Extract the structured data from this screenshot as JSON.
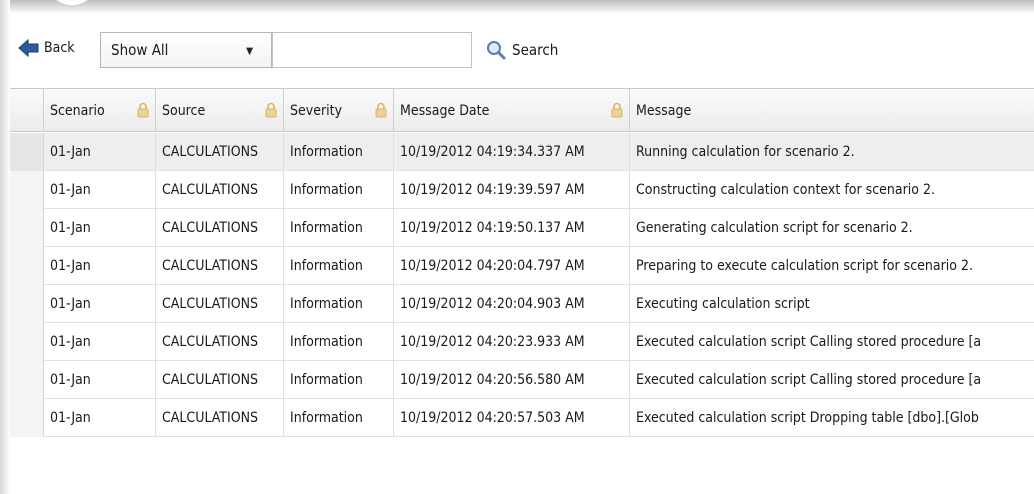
{
  "toolbar": {
    "back_label": "Back",
    "filter_selected": "Show All",
    "search_value": "",
    "search_label": "Search"
  },
  "grid": {
    "columns": [
      "Scenario",
      "Source",
      "Severity",
      "Message Date",
      "Message"
    ],
    "rows": [
      {
        "scenario": "01-Jan",
        "source": "CALCULATIONS",
        "severity": "Information",
        "date": "10/19/2012 04:19:34.337 AM",
        "message": "Running calculation for scenario 2."
      },
      {
        "scenario": "01-Jan",
        "source": "CALCULATIONS",
        "severity": "Information",
        "date": "10/19/2012 04:19:39.597 AM",
        "message": "Constructing calculation context for scenario 2."
      },
      {
        "scenario": "01-Jan",
        "source": "CALCULATIONS",
        "severity": "Information",
        "date": "10/19/2012 04:19:50.137 AM",
        "message": "Generating calculation script for scenario 2."
      },
      {
        "scenario": "01-Jan",
        "source": "CALCULATIONS",
        "severity": "Information",
        "date": "10/19/2012 04:20:04.797 AM",
        "message": "Preparing to execute calculation script for scenario 2."
      },
      {
        "scenario": "01-Jan",
        "source": "CALCULATIONS",
        "severity": "Information",
        "date": "10/19/2012 04:20:04.903 AM",
        "message": "Executing calculation script"
      },
      {
        "scenario": "01-Jan",
        "source": "CALCULATIONS",
        "severity": "Information",
        "date": "10/19/2012 04:20:23.933 AM",
        "message": "Executed calculation script Calling stored procedure [a"
      },
      {
        "scenario": "01-Jan",
        "source": "CALCULATIONS",
        "severity": "Information",
        "date": "10/19/2012 04:20:56.580 AM",
        "message": "Executed calculation script Calling stored procedure [a"
      },
      {
        "scenario": "01-Jan",
        "source": "CALCULATIONS",
        "severity": "Information",
        "date": "10/19/2012 04:20:57.503 AM",
        "message": "Executed calculation script Dropping table [dbo].[Glob"
      }
    ]
  },
  "colors": {
    "back_arrow": "#2a5d9b",
    "lock": "#e9c98a",
    "selected_row": "#eeeeee"
  },
  "icons": [
    "back-arrow-icon",
    "chevron-down-icon",
    "search-icon",
    "lock-icon"
  ]
}
